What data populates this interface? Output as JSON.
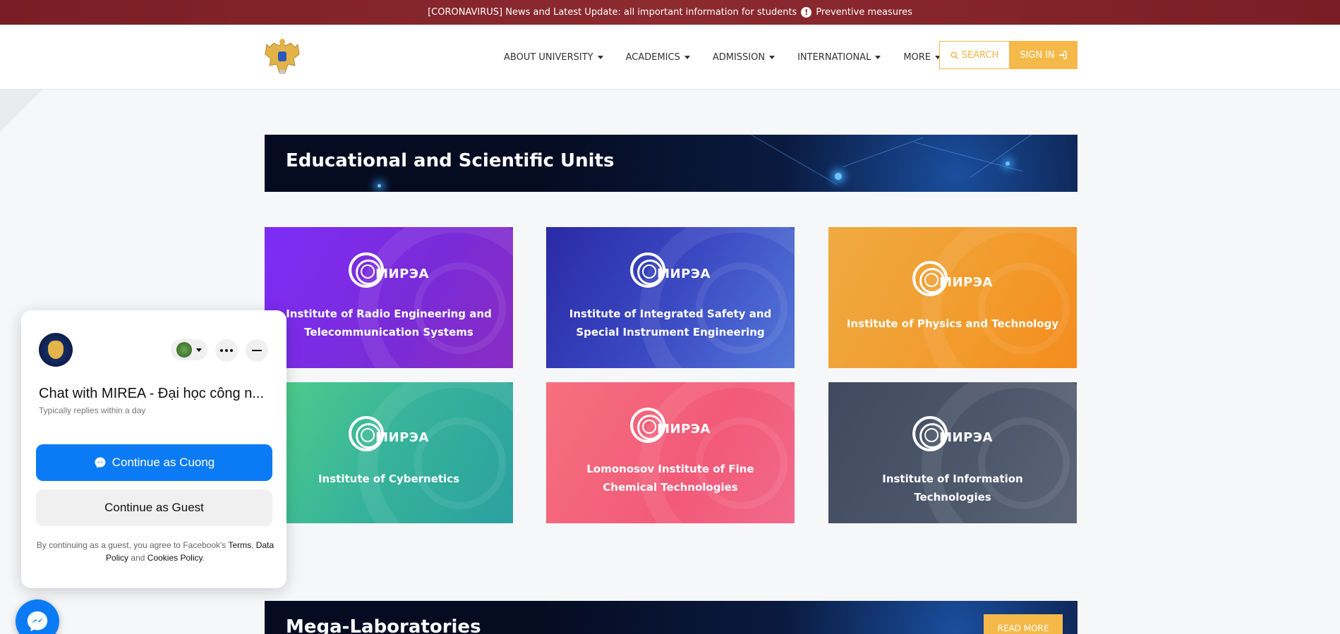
{
  "alert": {
    "text": "[CORONAVIRUS] News and Latest Update: all important information for students",
    "link": "Preventive measures"
  },
  "nav": {
    "items": [
      "ABOUT UNIVERSITY",
      "ACADEMICS",
      "ADMISSION",
      "INTERNATIONAL",
      "MORE"
    ],
    "search": "SEARCH",
    "signin": "SIGN IN"
  },
  "section1": {
    "title": "Educational and Scientific Units"
  },
  "cards": [
    {
      "name": "Institute of Radio Engineering and Telecommunication Systems",
      "logo": "МИРЭА"
    },
    {
      "name": "Institute of Integrated Safety and Special Instrument Engineering",
      "logo": "МИРЭА"
    },
    {
      "name": "Institute of Physics and Technology",
      "logo": "МИРЭА"
    },
    {
      "name": "Institute of Cybernetics",
      "logo": "МИРЭА"
    },
    {
      "name": "Lomonosov Institute of Fine Chemical Technologies",
      "logo": "МИРЭА"
    },
    {
      "name": "Institute of Information Technologies",
      "logo": "МИРЭА"
    }
  ],
  "section2": {
    "title": "Mega-Laboratories",
    "read_more": "READ MORE"
  },
  "fb": {
    "title": "Chat with MIREA - Đại học công n...",
    "subtitle": "Typically replies within a day",
    "primary": "Continue as Cuong",
    "secondary": "Continue as Guest",
    "legal_prefix": "By continuing as a guest, you agree to Facebook's",
    "terms": "Terms",
    "data_policy": "Data Policy",
    "and": "and",
    "cookies": "Cookies Policy",
    "primary_color": "#0b7bf5"
  },
  "colors": {
    "accent": "#f5b94a",
    "alert_bg": "#7a1d24"
  }
}
